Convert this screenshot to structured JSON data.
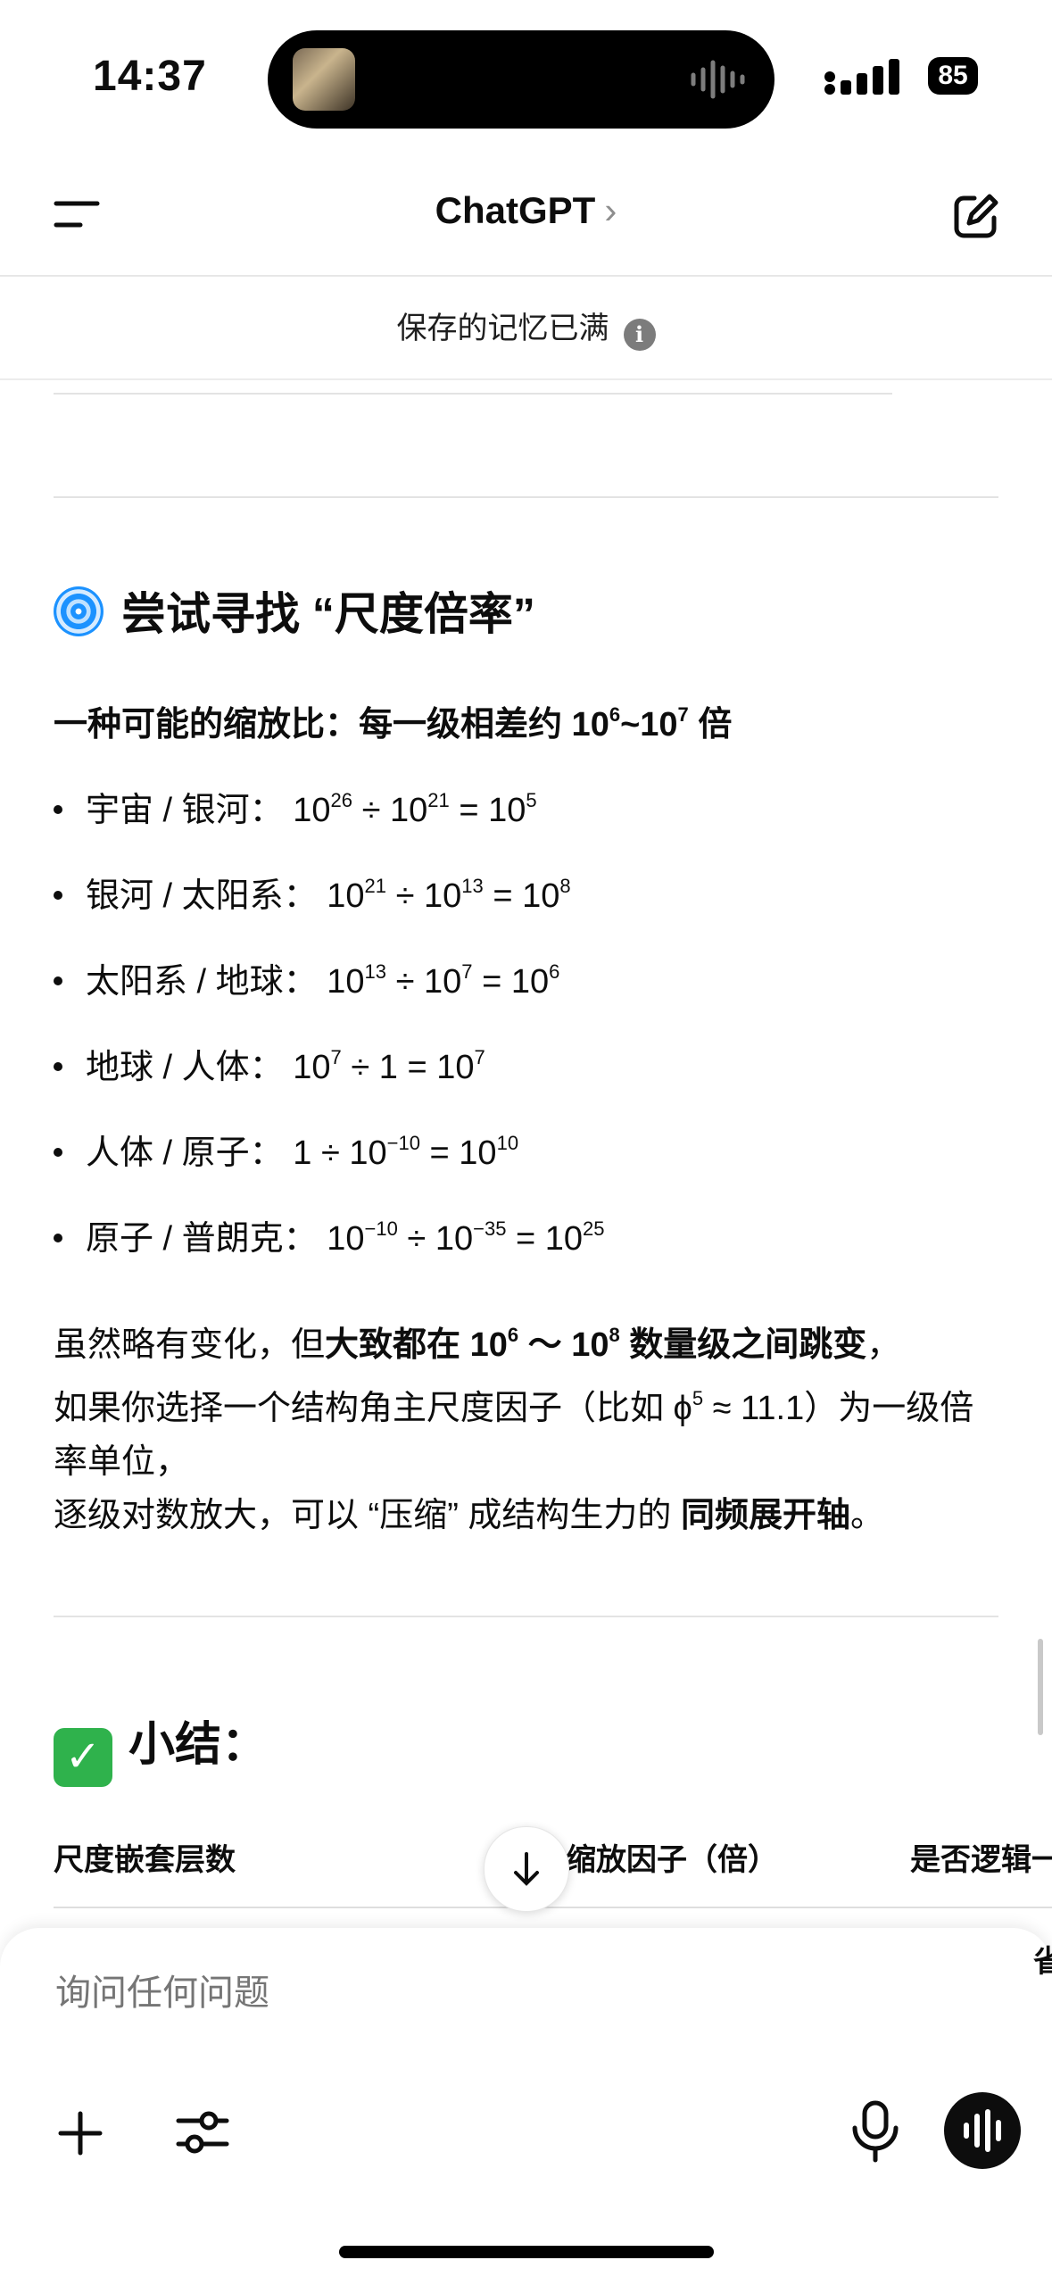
{
  "status_bar": {
    "time": "14:37",
    "battery": "85"
  },
  "header": {
    "title": "ChatGPT",
    "chevron": "›"
  },
  "banner": {
    "text": "保存的记忆已满",
    "info_glyph": "i"
  },
  "section_scale": {
    "heading": "尝试寻找 “尺度倍率”",
    "subheading_prefix": "一种可能的缩放比：每一级相差约 10",
    "subheading_exp1": "6",
    "subheading_mid": "~10",
    "subheading_exp2": "7",
    "subheading_suffix": " 倍",
    "bullets": [
      {
        "label": "宇宙 / 银河：",
        "a": "10",
        "ae": "26",
        "op": " ÷ ",
        "b": "10",
        "be": "21",
        "eq": " = ",
        "c": "10",
        "ce": "5"
      },
      {
        "label": "银河 / 太阳系：",
        "a": "10",
        "ae": "21",
        "op": " ÷ ",
        "b": "10",
        "be": "13",
        "eq": " = ",
        "c": "10",
        "ce": "8"
      },
      {
        "label": "太阳系 / 地球：",
        "a": "10",
        "ae": "13",
        "op": " ÷ ",
        "b": "10",
        "be": "7",
        "eq": " = ",
        "c": "10",
        "ce": "6"
      },
      {
        "label": "地球 / 人体：",
        "a": "10",
        "ae": "7",
        "op": " ÷ ",
        "b": "1",
        "be": "",
        "eq": " = ",
        "c": "10",
        "ce": "7"
      },
      {
        "label": "人体 / 原子：",
        "a": "1",
        "ae": "",
        "op": " ÷ ",
        "b": "10",
        "be": "−10",
        "eq": " = ",
        "c": "10",
        "ce": "10"
      },
      {
        "label": "原子 / 普朗克：",
        "a": "10",
        "ae": "−10",
        "op": " ÷ ",
        "b": "10",
        "be": "−35",
        "eq": " = ",
        "c": "10",
        "ce": "25"
      }
    ],
    "para_1a": "虽然略有变化，但",
    "para_1b": "大致都在 10",
    "para_1b_exp": "6",
    "para_1c": " ～ 10",
    "para_1c_exp": "8",
    "para_1d": " 数量级之间跳变",
    "para_1e": "，",
    "para_2a": "如果你选择一个结构角主尺度因子（比如 ϕ",
    "para_2a_exp": "5",
    "para_2b": " ≈ 11.1）为一级倍率单位，",
    "para_3a": "逐级对数放大，可以 “压缩” 成结构生力的 ",
    "para_3b": "同频展开轴",
    "para_3c": "。"
  },
  "section_summary": {
    "heading": "小结：",
    "columns": [
      "尺度嵌套层数",
      "缩放因子（倍）",
      "是否逻辑一"
    ],
    "clipped_cell": "省"
  },
  "composer": {
    "placeholder": "询问任何问题"
  },
  "icons": {
    "menu": "menu-icon",
    "edit": "compose-icon",
    "info": "info-icon",
    "down": "arrow-down-icon",
    "plus": "plus-icon",
    "tools": "sliders-icon",
    "mic": "microphone-icon",
    "voice": "voice-wave-icon"
  }
}
